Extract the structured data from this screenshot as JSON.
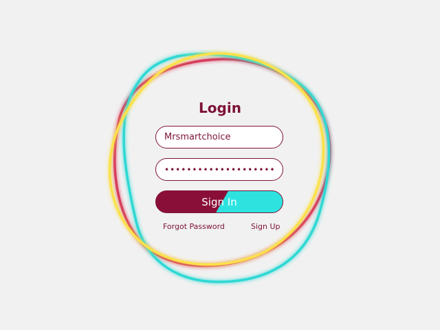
{
  "login": {
    "title": "Login",
    "username_value": "Mrsmartchoice",
    "password_value": "••••••••••••••••••••",
    "signin_label": "Sign In",
    "forgot_label": "Forgot Password",
    "signup_label": "Sign Up"
  },
  "colors": {
    "background": "#f1f1f1",
    "primary": "#8a0f38",
    "text": "#7d1238",
    "ring_crimson": "#d63a5c",
    "ring_cyan": "#2fd8d4",
    "ring_yellow": "#fbe14b"
  }
}
